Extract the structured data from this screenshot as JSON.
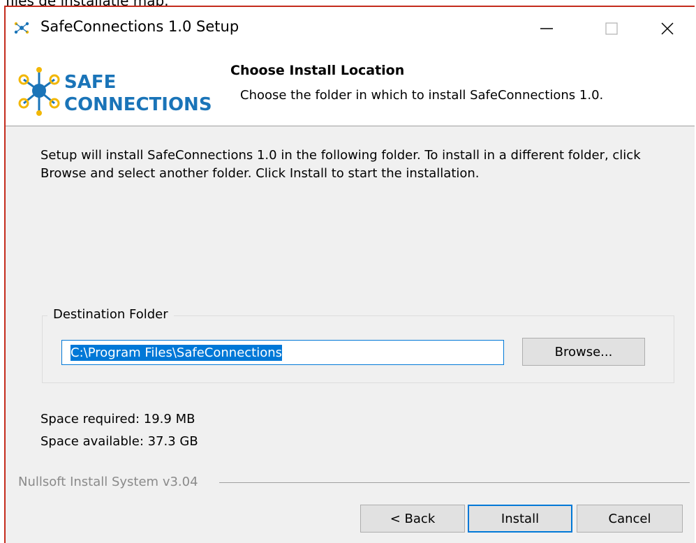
{
  "page_caption": "files de installatie map.",
  "window": {
    "title": "SafeConnections 1.0 Setup"
  },
  "logo": {
    "line1": "SAFE",
    "line2": "CONNECTIONS"
  },
  "header": {
    "title": "Choose Install Location",
    "subtitle": "Choose the folder in which to install SafeConnections 1.0."
  },
  "intro": {
    "text": "Setup will install SafeConnections 1.0 in the following folder. To install in a different folder, click Browse and select another folder. Click Install to start the installation."
  },
  "destination": {
    "label": "Destination Folder",
    "value": "C:\\Program Files\\SafeConnections",
    "browse_label": "Browse..."
  },
  "space": {
    "required": "Space required: 19.9 MB",
    "available": "Space available: 37.3 GB"
  },
  "footer": {
    "brand": "Nullsoft Install System v3.04",
    "back_label": "< Back",
    "install_label": "Install",
    "cancel_label": "Cancel"
  },
  "colors": {
    "window_border": "#c42b1c",
    "logo_blue": "#1a74b8",
    "logo_yellow": "#f2b705",
    "selection": "#0078d7",
    "dialog_background": "#f0f0f0"
  },
  "icons": {
    "app": "safeconnections-app-icon",
    "minimize": "minimize-icon",
    "maximize": "maximize-icon",
    "close": "close-icon"
  }
}
